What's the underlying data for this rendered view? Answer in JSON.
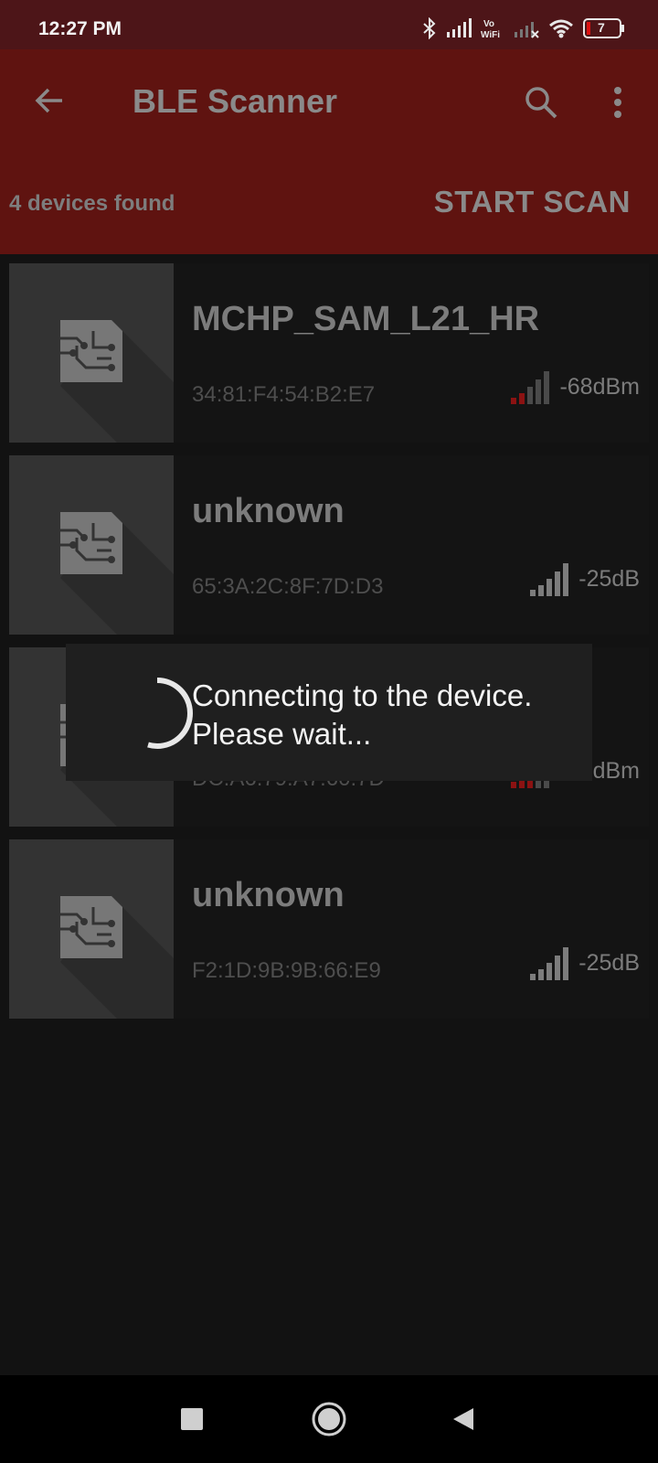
{
  "status_bar": {
    "time": "12:27 PM",
    "battery_level": "7",
    "icons": [
      "bluetooth-icon",
      "cell-signal-icon",
      "vowifi-icon",
      "cell-signal-2-icon",
      "wifi-icon",
      "battery-icon"
    ]
  },
  "app_bar": {
    "title": "BLE Scanner",
    "back_icon": "arrow-back-icon",
    "search_icon": "search-icon",
    "more_icon": "more-vert-icon",
    "color": "#5f1310"
  },
  "scan_bar": {
    "devices_found": "4 devices found",
    "start_scan_label": "START SCAN"
  },
  "devices": [
    {
      "name": "MCHP_SAM_L21_HR",
      "mac": "34:81:F4:54:B2:E7",
      "rssi": "-68dBm",
      "signal_bars_filled": 2,
      "signal_color": "#8b1212"
    },
    {
      "name": "unknown",
      "mac": "65:3A:2C:8F:7D:D3",
      "rssi": "-25dB",
      "signal_bars_filled": 5,
      "signal_color": "#7c7c7c"
    },
    {
      "name": "",
      "mac": "DC:A6:79:A7:60:7D",
      "rssi": "-60dBm",
      "signal_bars_filled": 3,
      "signal_color": "#8b1212"
    },
    {
      "name": "unknown",
      "mac": "F2:1D:9B:9B:66:E9",
      "rssi": "-25dB",
      "signal_bars_filled": 5,
      "signal_color": "#7c7c7c"
    }
  ],
  "dialog": {
    "line1": "Connecting to the device.",
    "line2": "Please wait..."
  },
  "nav_bar": {
    "icons": [
      "recents-square-icon",
      "home-circle-icon",
      "back-triangle-icon"
    ]
  }
}
